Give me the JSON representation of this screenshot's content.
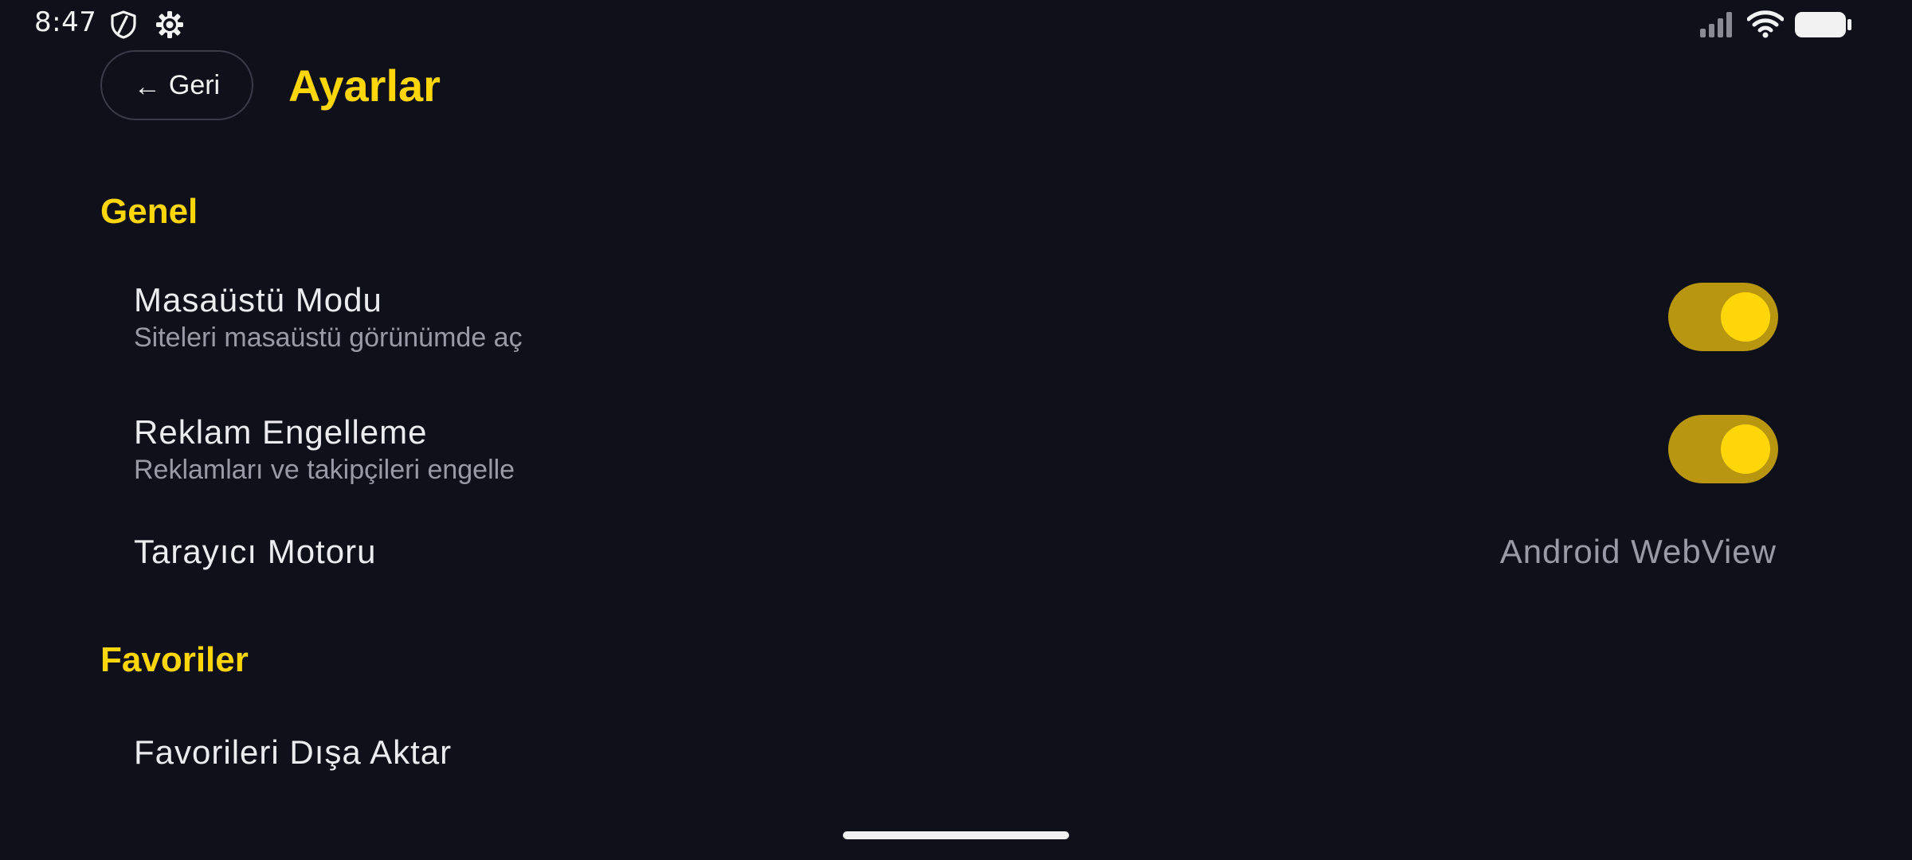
{
  "status_bar": {
    "time": "8:47",
    "icons": [
      "shield-icon",
      "gear-icon",
      "signal-icon",
      "wifi-icon",
      "battery-icon"
    ]
  },
  "header": {
    "back_arrow": "←",
    "back_label": "Geri",
    "title": "Ayarlar"
  },
  "sections": {
    "general": {
      "title": "Genel",
      "desktop_mode": {
        "title": "Masaüstü Modu",
        "subtitle": "Siteleri masaüstü görünümde aç",
        "enabled": true
      },
      "ad_block": {
        "title": "Reklam Engelleme",
        "subtitle": "Reklamları ve takipçileri engelle",
        "enabled": true
      },
      "browser_engine": {
        "title": "Tarayıcı Motoru",
        "value": "Android WebView"
      }
    },
    "favorites": {
      "title": "Favoriler",
      "export": {
        "title": "Favorileri Dışa Aktar"
      }
    }
  },
  "colors": {
    "background": "#10101a",
    "accent": "#ffd60a",
    "toggle_track_on": "#b8960f",
    "secondary_text": "#9a9aa6"
  }
}
